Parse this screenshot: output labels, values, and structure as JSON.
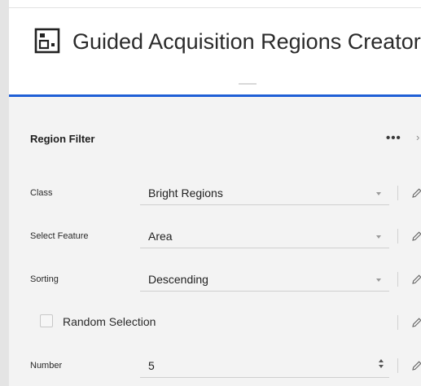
{
  "header": {
    "title": "Guided Acquisition Regions Creator",
    "icon": "app-square-dot-icon"
  },
  "panel": {
    "title": "Region Filter",
    "more_label": "•••",
    "rows": [
      {
        "label": "Class",
        "value": "Bright Regions",
        "control": "dropdown"
      },
      {
        "label": "Select Feature",
        "value": "Area",
        "control": "dropdown"
      },
      {
        "label": "Sorting",
        "value": "Descending",
        "control": "dropdown"
      },
      {
        "label": "Number",
        "value": "5",
        "control": "spinner"
      }
    ],
    "checkbox": {
      "label": "Random Selection",
      "checked": false
    }
  },
  "colors": {
    "accent": "#1f5fd6",
    "panel_bg": "#f3f3f3"
  }
}
